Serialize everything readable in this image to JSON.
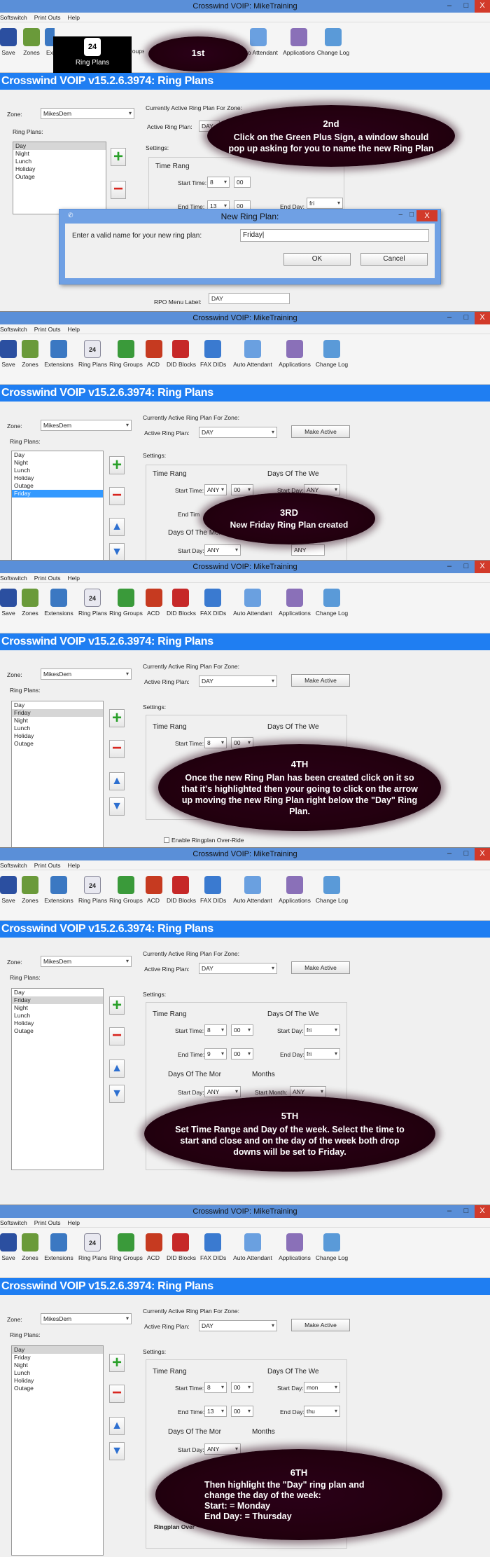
{
  "app": {
    "window_title": "Crosswind VOIP: MikeTraining",
    "banner": "Crosswind VOIP v15.2.6.3974: Ring Plans",
    "menu": [
      "Softswitch",
      "Print Outs",
      "Help"
    ],
    "toolbar": [
      "Save",
      "Zones",
      "Extensions",
      "Ring Plans",
      "Ring Groups",
      "ACD",
      "DID Blocks",
      "FAX DIDs",
      "Auto Attendant",
      "Applications",
      "Change Log"
    ],
    "calendar_day": "24",
    "window_buttons": {
      "minimize": "–",
      "maximize": "□",
      "close": "X"
    }
  },
  "form": {
    "zone_label": "Zone:",
    "zone_value": "MikesDem",
    "ring_plans_label": "Ring Plans:",
    "current_label": "Currently Active Ring Plan For Zone:",
    "active_label": "Active Ring Plan:",
    "active_value": "DAY",
    "make_active": "Make Active",
    "settings_label": "Settings:",
    "time_range": "Time Rang",
    "days_week": "Days Of The We",
    "days_month": "Days Of The Mor",
    "months": "Months",
    "start_time": "Start Time:",
    "end_time": "End Time:",
    "start_day": "Start Day:",
    "end_day": "End Day:",
    "start_month": "Start Month:",
    "rpo_label": "RPO Menu Label:",
    "rpo_value": "DAY",
    "enable_override": "Enable Ringplan Over-Ride",
    "override_label": "Ringplan Over"
  },
  "steps": [
    {
      "plans": [
        "Day",
        "Night",
        "Lunch",
        "Holiday",
        "Outage"
      ],
      "start_hour": "8",
      "start_min": "00",
      "end_hour": "13",
      "end_min": "00",
      "start_day": "",
      "end_day": "fri",
      "callout_tb": "1st",
      "callout_num": "2nd",
      "callout": "Click on the Green Plus Sign, a window should pop up asking for you to name the new Ring Plan",
      "dialog": {
        "title": "New Ring Plan:",
        "prompt": "Enter a valid name for your new ring plan:",
        "value": "Friday",
        "ok": "OK",
        "cancel": "Cancel"
      }
    },
    {
      "plans": [
        "Day",
        "Night",
        "Lunch",
        "Holiday",
        "Outage",
        "Friday"
      ],
      "start_hour": "ANY",
      "start_min": "00",
      "start_day": "ANY",
      "dom_start": "ANY",
      "dom_end": "ANY",
      "callout_num": "3RD",
      "callout": "New Friday Ring Plan created"
    },
    {
      "plans": [
        "Day",
        "Friday",
        "Night",
        "Lunch",
        "Holiday",
        "Outage"
      ],
      "start_hour": "8",
      "start_min": "00",
      "callout_num": "4TH",
      "callout": "Once the new Ring Plan has been created click on it so that it's highlighted then your going to click on the arrow up moving the new Ring Plan right below the \"Day\" Ring Plan."
    },
    {
      "plans": [
        "Day",
        "Friday",
        "Night",
        "Lunch",
        "Holiday",
        "Outage"
      ],
      "start_hour": "8",
      "start_min": "00",
      "end_hour": "9",
      "end_min": "00",
      "start_day": "fri",
      "end_day": "fri",
      "dom_start": "ANY",
      "month_start": "ANY",
      "callout_num": "5TH",
      "callout": "Set Time Range and Day of the week. Select the time to start and close and on the day of the week both drop downs will be set to Friday."
    },
    {
      "plans": [
        "Day",
        "Friday",
        "Night",
        "Lunch",
        "Holiday",
        "Outage"
      ],
      "start_hour": "8",
      "start_min": "00",
      "end_hour": "13",
      "end_min": "00",
      "start_day": "mon",
      "end_day": "thu",
      "dom_start": "ANY",
      "callout_num": "6TH",
      "callout": "Then highlight the \"Day\" ring plan and change the day of the week:",
      "callout_line2": "Start: = Monday",
      "callout_line3": "End Day: = Thursday"
    }
  ]
}
